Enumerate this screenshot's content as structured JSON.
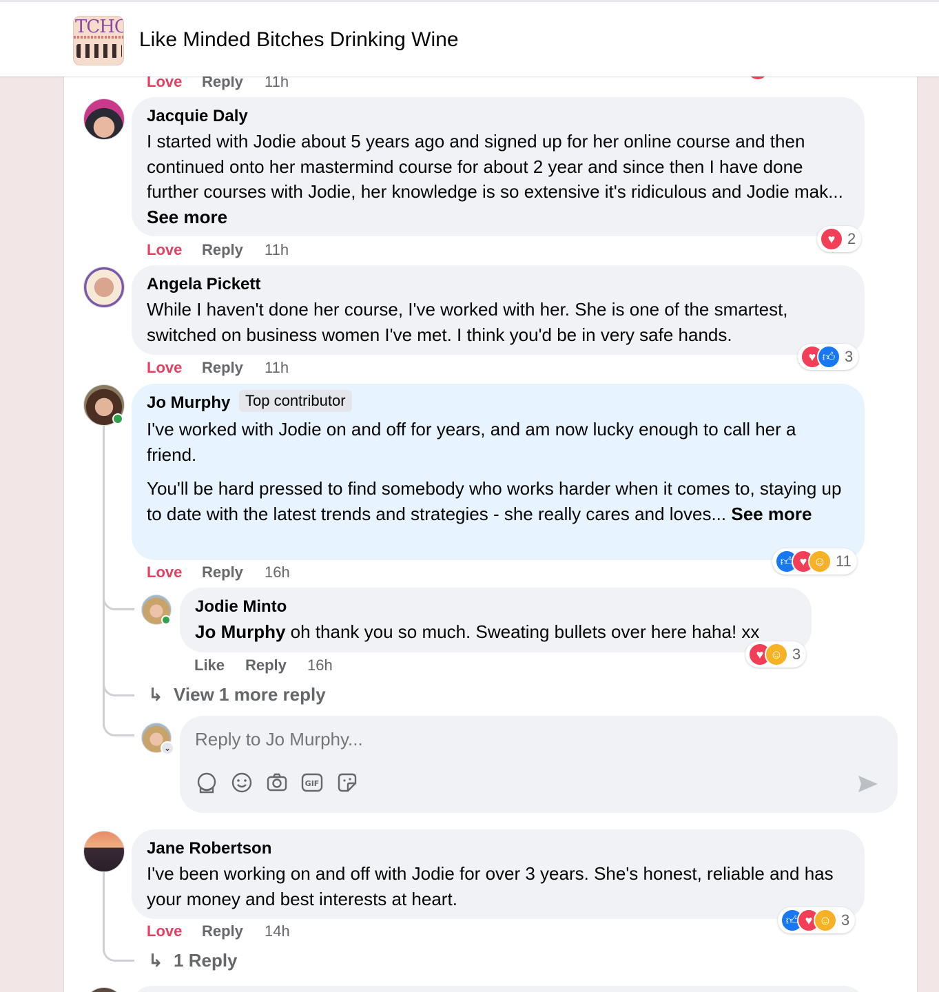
{
  "group": {
    "title": "Like Minded Bitches Drinking Wine",
    "thumb_text": "TCHC"
  },
  "actions_labels": {
    "love": "Love",
    "like": "Like",
    "reply": "Reply"
  },
  "top_partial": {
    "time": "11h"
  },
  "comments": [
    {
      "author": "Jacquie Daly",
      "text": "I started with Jodie about 5 years ago and signed up for her online course and then continued onto her mastermind course for about 2 year and since then I have done further courses with Jodie, her knowledge is so extensive it's ridiculous and Jodie mak...",
      "see_more": "See more",
      "time": "11h",
      "reaction_count": "2",
      "reactions": [
        "love"
      ]
    },
    {
      "author": "Angela Pickett",
      "text": "While I haven't done her course, I've worked with her. She is one of the smartest, switched on business women I've met. I think you'd be in very safe hands.",
      "time": "11h",
      "reaction_count": "3",
      "reactions": [
        "love",
        "like"
      ]
    },
    {
      "author": "Jo Murphy",
      "badge": "Top contributor",
      "text_p1": "I've worked with Jodie on and off for years, and am now lucky enough to call her a friend.",
      "text_p2": "You'll be hard pressed to find somebody who works harder when it comes to, staying up to date with the latest trends and strategies - she really cares and loves...",
      "see_more": "See more",
      "time": "16h",
      "reaction_count": "11",
      "reactions": [
        "like",
        "love",
        "care"
      ],
      "reply": {
        "author": "Jodie Minto",
        "mention": "Jo Murphy",
        "text": " oh thank you so much. Sweating bullets over here haha! xx",
        "time": "16h",
        "reaction_count": "3",
        "reactions": [
          "love",
          "care"
        ]
      },
      "view_more": "View 1 more reply",
      "reply_placeholder": "Reply to Jo Murphy..."
    },
    {
      "author": "Jane Robertson",
      "text": "I've been working on and off with Jodie for over 3 years. She's honest, reliable and has your money and best interests at heart.",
      "time": "14h",
      "reaction_count": "3",
      "reactions": [
        "like",
        "love",
        "care"
      ],
      "replies_link": "1 Reply"
    }
  ],
  "composer_tools": [
    "avatar-sticker-icon",
    "emoji-icon",
    "camera-icon",
    "gif-icon",
    "sticker-icon",
    "send-icon"
  ],
  "colors": {
    "love": "#e4405f",
    "bubble": "#f0f2f5",
    "bubble_highlight": "#e7f3ff",
    "like": "#1877f2",
    "online": "#31a24c"
  }
}
